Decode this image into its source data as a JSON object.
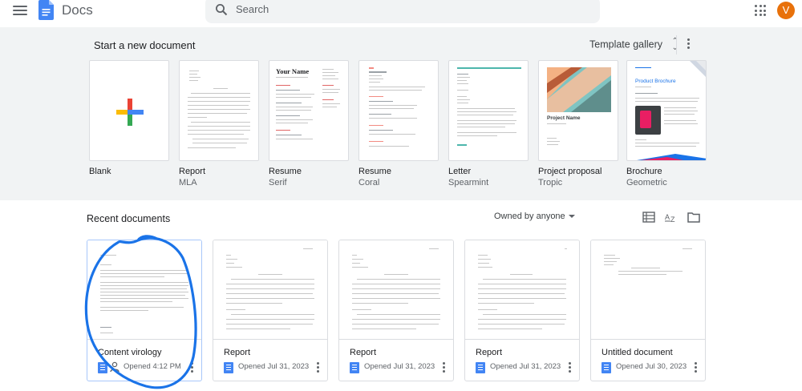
{
  "header": {
    "app_title": "Docs",
    "search_placeholder": "Search",
    "avatar_initial": "V"
  },
  "templates_section": {
    "title": "Start a new document",
    "gallery_label": "Template gallery",
    "items": [
      {
        "name": "Blank",
        "sub": ""
      },
      {
        "name": "Report",
        "sub": "MLA"
      },
      {
        "name": "Resume",
        "sub": "Serif",
        "thumb_heading": "Your Name"
      },
      {
        "name": "Resume",
        "sub": "Coral"
      },
      {
        "name": "Letter",
        "sub": "Spearmint"
      },
      {
        "name": "Project proposal",
        "sub": "Tropic",
        "thumb_heading": "Project Name"
      },
      {
        "name": "Brochure",
        "sub": "Geometric",
        "thumb_heading": "Product Brochure"
      }
    ]
  },
  "recent": {
    "title": "Recent documents",
    "owner_filter": "Owned by anyone",
    "documents": [
      {
        "title": "Content virology",
        "meta": "Opened 4:12 PM",
        "shared": true
      },
      {
        "title": "Report",
        "meta": "Opened Jul 31, 2023",
        "shared": false
      },
      {
        "title": "Report",
        "meta": "Opened Jul 31, 2023",
        "shared": false
      },
      {
        "title": "Report",
        "meta": "Opened Jul 31, 2023",
        "shared": false
      },
      {
        "title": "Untitled document",
        "meta": "Opened Jul 30, 2023",
        "shared": false
      }
    ]
  },
  "colors": {
    "accent_blue": "#4285f4",
    "avatar_orange": "#e8710a",
    "annotation_blue": "#1a73e8",
    "section_bg": "#f1f3f4"
  },
  "icons": [
    "menu-icon",
    "docs-logo-icon",
    "search-icon",
    "apps-grid-icon",
    "unfold-icon",
    "more-vert-icon",
    "list-view-icon",
    "sort-az-icon",
    "folder-icon",
    "doc-icon",
    "people-icon"
  ]
}
